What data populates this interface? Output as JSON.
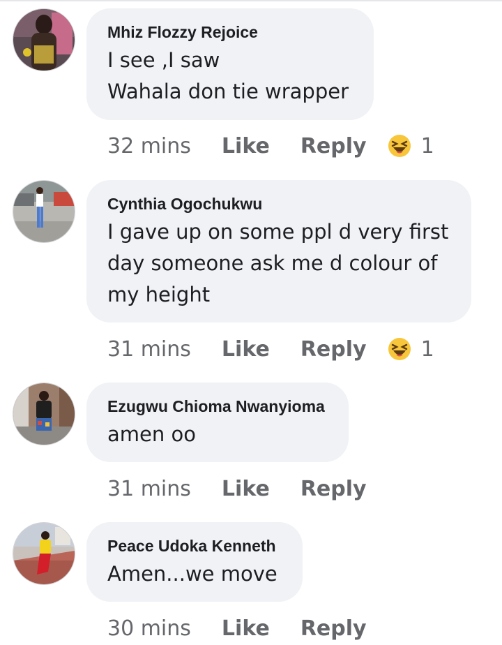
{
  "comments": [
    {
      "author": "Mhiz Flozzy Rejoice",
      "text": "I see ,I saw\nWahala don tie wrapper",
      "time": "32 mins",
      "like_label": "Like",
      "reply_label": "Reply",
      "reaction": {
        "icon": "haha-emoji-icon",
        "count": "1"
      }
    },
    {
      "author": "Cynthia Ogochukwu",
      "text": "I gave up on some ppl d very first\nday someone ask me d colour of\nmy height",
      "time": "31 mins",
      "like_label": "Like",
      "reply_label": "Reply",
      "reaction": {
        "icon": "haha-emoji-icon",
        "count": "1"
      }
    },
    {
      "author": "Ezugwu Chioma Nwanyioma",
      "text": "amen oo",
      "time": "31 mins",
      "like_label": "Like",
      "reply_label": "Reply"
    },
    {
      "author": "Peace Udoka Kenneth",
      "text": "Amen...we move",
      "time": "30 mins",
      "like_label": "Like",
      "reply_label": "Reply"
    }
  ],
  "colors": {
    "bubble": "#f0f2f5",
    "text": "#1c1e21",
    "meta": "#65676b",
    "reaction_yellow": "#f7c63a"
  }
}
